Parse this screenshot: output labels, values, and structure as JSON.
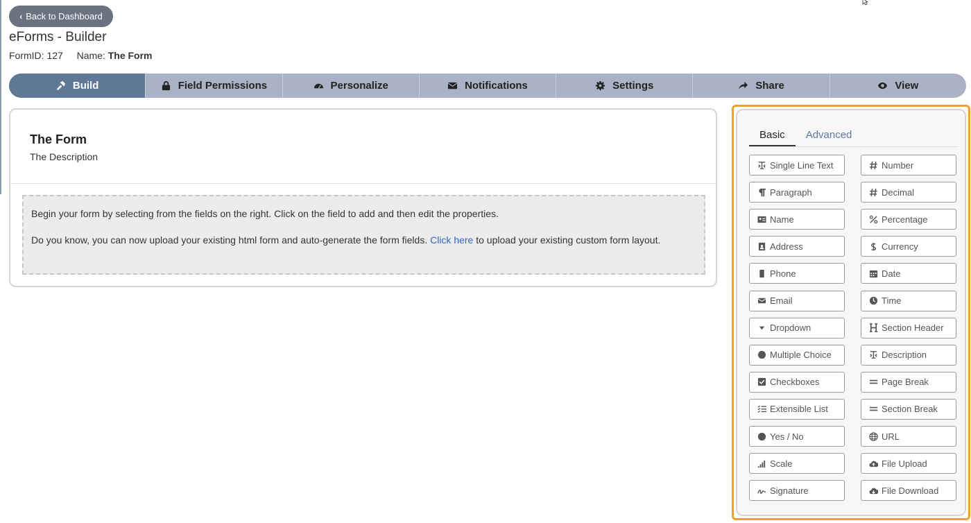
{
  "back_button": {
    "label": "Back to Dashboard"
  },
  "app_title": "eForms - Builder",
  "form_meta": {
    "id_label": "FormID:",
    "id_value": "127",
    "name_label": "Name:",
    "name_value": "The Form"
  },
  "tabs": [
    {
      "label": "Build",
      "icon": "hammer-icon",
      "active": true
    },
    {
      "label": "Field Permissions",
      "icon": "lock-icon"
    },
    {
      "label": "Personalize",
      "icon": "gauge-icon"
    },
    {
      "label": "Notifications",
      "icon": "envelope-icon"
    },
    {
      "label": "Settings",
      "icon": "gear-icon"
    },
    {
      "label": "Share",
      "icon": "share-icon"
    },
    {
      "label": "View",
      "icon": "eye-icon"
    }
  ],
  "form": {
    "title": "The Form",
    "description": "The Description",
    "info_line1": "Begin your form by selecting from the fields on the right. Click on the field to add and then edit the properties.",
    "info_line2_pre": "Do you know, you can now upload your existing html form and auto-generate the form fields. ",
    "info_link": "Click here",
    "info_line2_post": " to upload your existing custom form layout."
  },
  "palette": {
    "tabs": [
      {
        "label": "Basic",
        "active": true
      },
      {
        "label": "Advanced"
      }
    ],
    "fields_left": [
      {
        "label": "Single Line Text",
        "icon": "text-cursor-icon"
      },
      {
        "label": "Paragraph",
        "icon": "paragraph-icon"
      },
      {
        "label": "Name",
        "icon": "id-card-icon"
      },
      {
        "label": "Address",
        "icon": "address-book-icon"
      },
      {
        "label": "Phone",
        "icon": "phone-icon"
      },
      {
        "label": "Email",
        "icon": "envelope-icon"
      },
      {
        "label": "Dropdown",
        "icon": "caret-down-icon"
      },
      {
        "label": "Multiple Choice",
        "icon": "circle-icon"
      },
      {
        "label": "Checkboxes",
        "icon": "checkbox-icon"
      },
      {
        "label": "Extensible List",
        "icon": "list-check-icon"
      },
      {
        "label": "Yes / No",
        "icon": "circle-icon"
      },
      {
        "label": "Scale",
        "icon": "signal-bars-icon"
      },
      {
        "label": "Signature",
        "icon": "signature-icon"
      }
    ],
    "fields_right": [
      {
        "label": "Number",
        "icon": "hash-icon"
      },
      {
        "label": "Decimal",
        "icon": "hash-icon"
      },
      {
        "label": "Percentage",
        "icon": "percent-icon"
      },
      {
        "label": "Currency",
        "icon": "dollar-icon"
      },
      {
        "label": "Date",
        "icon": "calendar-icon"
      },
      {
        "label": "Time",
        "icon": "clock-icon"
      },
      {
        "label": "Section Header",
        "icon": "heading-icon"
      },
      {
        "label": "Description",
        "icon": "text-cursor-icon"
      },
      {
        "label": "Page Break",
        "icon": "equals-icon"
      },
      {
        "label": "Section Break",
        "icon": "equals-icon"
      },
      {
        "label": "URL",
        "icon": "globe-icon"
      },
      {
        "label": "File Upload",
        "icon": "cloud-upload-icon"
      },
      {
        "label": "File Download",
        "icon": "cloud-download-icon"
      }
    ]
  },
  "colors": {
    "accent_orange": "#f0a030",
    "tab_active": "#5f7896",
    "tab_bar": "#a9b3c5",
    "link": "#2f6ab8"
  }
}
